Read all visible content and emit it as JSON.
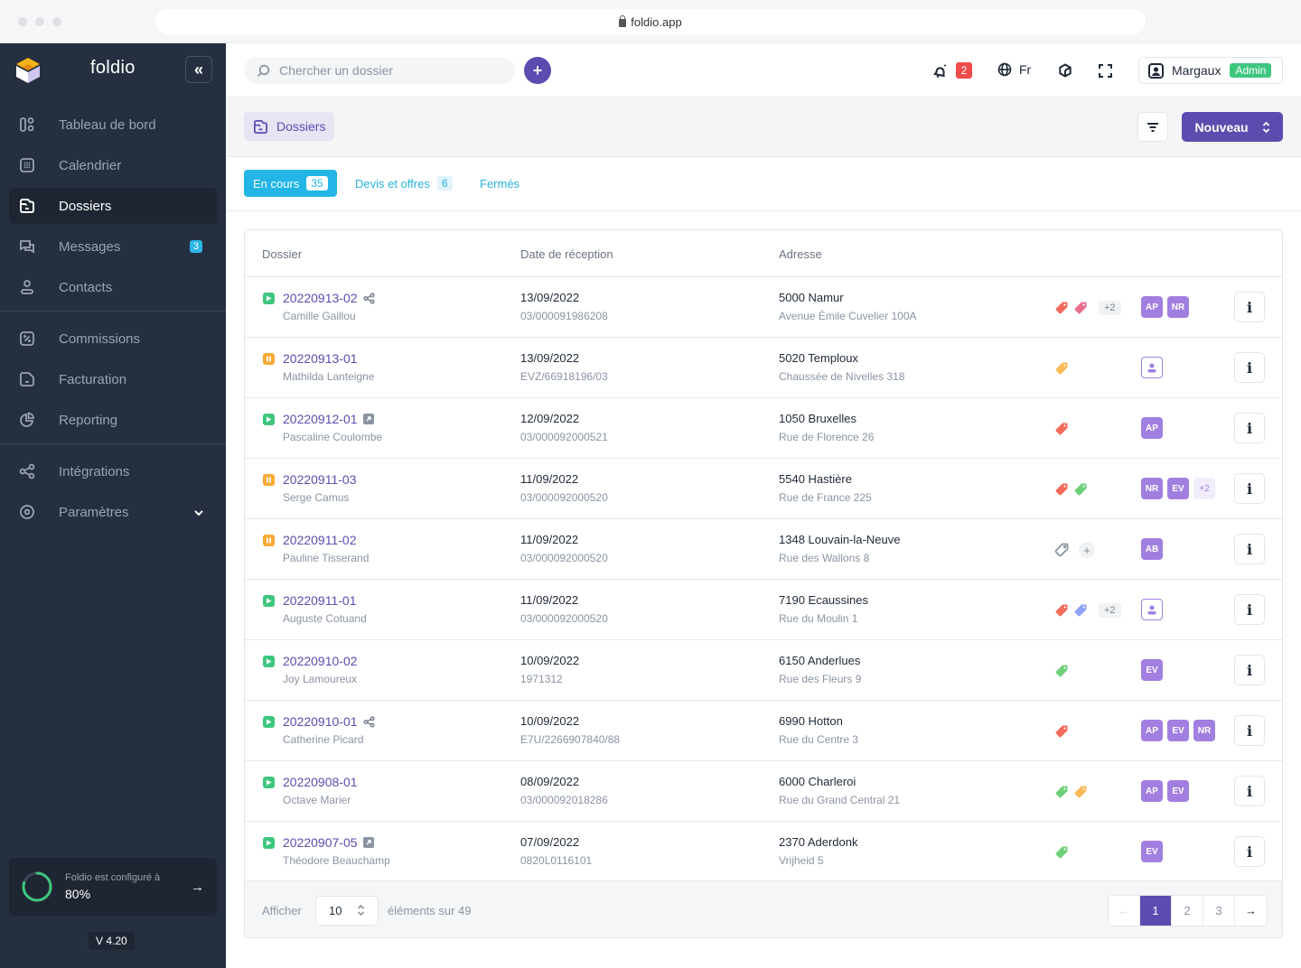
{
  "browser": {
    "url": "foldio.app"
  },
  "sidebar": {
    "brand": "foldio",
    "collapse_icon": "chevrons-left-icon",
    "items": [
      {
        "label": "Tableau de bord",
        "icon": "dashboard-icon"
      },
      {
        "label": "Calendrier",
        "icon": "calendar-icon"
      },
      {
        "label": "Dossiers",
        "icon": "folder-icon",
        "active": true
      },
      {
        "label": "Messages",
        "icon": "messages-icon",
        "badge": "3"
      },
      {
        "label": "Contacts",
        "icon": "user-icon"
      },
      {
        "label": "Commissions",
        "icon": "percent-icon"
      },
      {
        "label": "Facturation",
        "icon": "invoice-icon"
      },
      {
        "label": "Reporting",
        "icon": "pie-chart-icon"
      },
      {
        "label": "Intégrations",
        "icon": "share-icon"
      },
      {
        "label": "Paramètres",
        "icon": "settings-icon",
        "expandable": true
      }
    ],
    "config": {
      "label": "Foldio est configuré à",
      "value": "80%",
      "progress": 0.8
    },
    "version": "V 4.20"
  },
  "topbar": {
    "search_placeholder": "Chercher un dossier",
    "notifications_count": "2",
    "language": "Fr",
    "user_name": "Margaux",
    "user_role": "Admin"
  },
  "page": {
    "breadcrumb": "Dossiers",
    "new_button": "Nouveau",
    "tabs": [
      {
        "label": "En cours",
        "count": "35",
        "active": true
      },
      {
        "label": "Devis et offres",
        "count": "6"
      },
      {
        "label": "Fermés"
      }
    ]
  },
  "table": {
    "columns": [
      "Dossier",
      "Date de réception",
      "Adresse"
    ],
    "rows": [
      {
        "status": "play",
        "ref": "20220913-02",
        "ref_icon": "share",
        "client": "Camille Gaillou",
        "date": "13/09/2022",
        "number": "03/000091986208",
        "city": "5000 Namur",
        "street": "Avenue Émile Cuvelier 100A",
        "tags": [
          "#f26b5b",
          "#ea6f8f"
        ],
        "tags_more": "+2",
        "avatars": [
          "AP",
          "NR"
        ]
      },
      {
        "status": "pause",
        "ref": "20220913-01",
        "client": "Mathilda Lanteigne",
        "date": "13/09/2022",
        "number": "EVZ/66918196/03",
        "city": "5020 Temploux",
        "street": "Chaussée de Nivelles 318",
        "tags": [
          "#fbb957"
        ],
        "avatars": [],
        "avatar_empty": true
      },
      {
        "status": "play",
        "ref": "20220912-01",
        "ref_icon": "external",
        "client": "Pascaline Coulombe",
        "date": "12/09/2022",
        "number": "03/000092000521",
        "city": "1050 Bruxelles",
        "street": "Rue de Florence 26",
        "tags": [
          "#f26b5b"
        ],
        "avatars": [
          "AP"
        ]
      },
      {
        "status": "pause",
        "ref": "20220911-03",
        "client": "Serge Camus",
        "date": "11/09/2022",
        "number": "03/000092000520",
        "city": "5540 Hastière",
        "street": "Rue de France 225",
        "tags": [
          "#f26b5b",
          "#6fd07a"
        ],
        "avatars": [
          "NR",
          "EV"
        ],
        "avatars_more": "+2"
      },
      {
        "status": "pause",
        "ref": "20220911-02",
        "client": "Pauline Tisserand",
        "date": "11/09/2022",
        "number": "03/000092000520",
        "city": "1348 Louvain-la-Neuve",
        "street": "Rue des Wallons 8",
        "tags": [],
        "tag_empty": true,
        "avatars": [
          "AB"
        ]
      },
      {
        "status": "play",
        "ref": "20220911-01",
        "client": "Auguste Cotuand",
        "date": "11/09/2022",
        "number": "03/000092000520",
        "city": "7190 Ecaussines",
        "street": "Rue du Moulin 1",
        "tags": [
          "#f26b5b",
          "#8fa2f7"
        ],
        "tags_more": "+2",
        "avatars": [],
        "avatar_empty": true
      },
      {
        "status": "play",
        "ref": "20220910-02",
        "client": "Joy Lamoureux",
        "date": "10/09/2022",
        "number": "1971312",
        "city": "6150 Anderlues",
        "street": "Rue des Fleurs 9",
        "tags": [
          "#6fd07a"
        ],
        "avatars": [
          "EV"
        ]
      },
      {
        "status": "play",
        "ref": "20220910-01",
        "ref_icon": "share",
        "client": "Catherine Picard",
        "date": "10/09/2022",
        "number": "E7U/2266907840/88",
        "city": "6990 Hotton",
        "street": "Rue du Centre 3",
        "tags": [
          "#f26b5b"
        ],
        "avatars": [
          "AP",
          "EV",
          "NR"
        ]
      },
      {
        "status": "play",
        "ref": "20220908-01",
        "client": "Octave Marier",
        "date": "08/09/2022",
        "number": "03/000092018286",
        "city": "6000 Charleroi",
        "street": "Rue du Grand Central 21",
        "tags": [
          "#6fd07a",
          "#fbb957"
        ],
        "avatars": [
          "AP",
          "EV"
        ]
      },
      {
        "status": "play",
        "ref": "20220907-05",
        "ref_icon": "external",
        "client": "Théodore Beauchamp",
        "date": "07/09/2022",
        "number": "0820L0116101",
        "city": "2370 Aderdonk",
        "street": "Vrijheid 5",
        "tags": [
          "#6fd07a"
        ],
        "avatars": [
          "EV"
        ]
      }
    ],
    "info_label": "i"
  },
  "footer": {
    "show_label": "Afficher",
    "per_page": "10",
    "total_label": "éléments sur 49",
    "pages": [
      "1",
      "2",
      "3"
    ],
    "current_page": "1",
    "prev": "←",
    "next": "→"
  }
}
